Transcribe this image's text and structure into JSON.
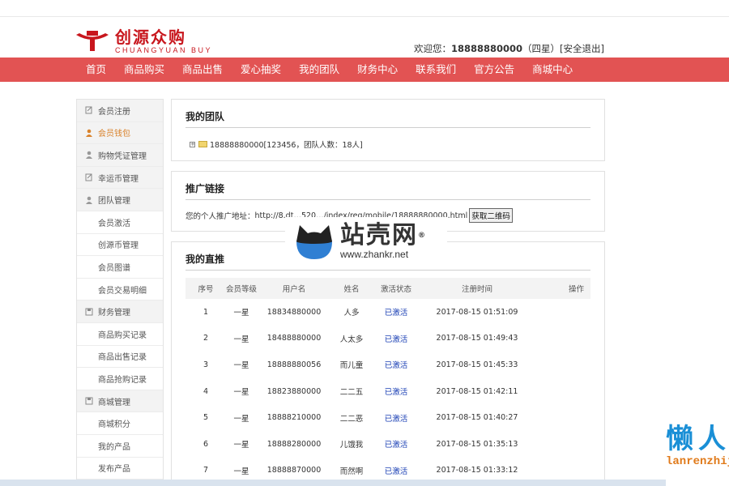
{
  "header": {
    "logo_cn": "创源众购",
    "logo_en": "CHUANGYUAN BUY",
    "welcome_prefix": "欢迎您：",
    "phone": "18888880000",
    "rank": "（四星）",
    "logout": "[安全退出]"
  },
  "nav": [
    "首页",
    "商品购买",
    "商品出售",
    "爱心抽奖",
    "我的团队",
    "财务中心",
    "联系我们",
    "官方公告",
    "商城中心"
  ],
  "sidebar": [
    {
      "label": "会员注册",
      "type": "group",
      "icon": "edit-icon"
    },
    {
      "label": "会员钱包",
      "type": "group",
      "icon": "user-icon",
      "active": true
    },
    {
      "label": "购物凭证管理",
      "type": "group",
      "icon": "user-icon"
    },
    {
      "label": "幸运币管理",
      "type": "group",
      "icon": "edit-icon"
    },
    {
      "label": "团队管理",
      "type": "group",
      "icon": "user-icon"
    },
    {
      "label": "会员激活",
      "type": "child"
    },
    {
      "label": "创源币管理",
      "type": "child"
    },
    {
      "label": "会员图谱",
      "type": "child"
    },
    {
      "label": "会员交易明细",
      "type": "child"
    },
    {
      "label": "财务管理",
      "type": "group",
      "icon": "save-icon"
    },
    {
      "label": "商品购买记录",
      "type": "child"
    },
    {
      "label": "商品出售记录",
      "type": "child"
    },
    {
      "label": "商品抢购记录",
      "type": "child"
    },
    {
      "label": "商城管理",
      "type": "group",
      "icon": "save-icon"
    },
    {
      "label": "商城积分",
      "type": "child"
    },
    {
      "label": "我的产品",
      "type": "child"
    },
    {
      "label": "发布产品",
      "type": "child"
    }
  ],
  "team": {
    "title": "我的团队",
    "node": "18888880000[123456，团队人数：18人]"
  },
  "promo": {
    "title": "推广链接",
    "label": "您的个人推广地址：",
    "url": "http://8.dt…520…/index/reg/mobile/18888880000.html",
    "qr_button": "获取二维码"
  },
  "direct": {
    "title": "我的直推",
    "columns": [
      "序号",
      "会员等级",
      "用户名",
      "姓名",
      "激活状态",
      "注册时间",
      "操作"
    ],
    "rows": [
      [
        "1",
        "一星",
        "18834880000",
        "人多",
        "已激活",
        "2017-08-15 01:51:09",
        ""
      ],
      [
        "2",
        "一星",
        "18488880000",
        "人太多",
        "已激活",
        "2017-08-15 01:49:43",
        ""
      ],
      [
        "3",
        "一星",
        "18888880056",
        "而儿童",
        "已激活",
        "2017-08-15 01:45:33",
        ""
      ],
      [
        "4",
        "一星",
        "18823880000",
        "二二五",
        "已激活",
        "2017-08-15 01:42:11",
        ""
      ],
      [
        "5",
        "一星",
        "18888210000",
        "二二恶",
        "已激活",
        "2017-08-15 01:40:27",
        ""
      ],
      [
        "6",
        "一星",
        "18888280000",
        "儿饿我",
        "已激活",
        "2017-08-15 01:35:13",
        ""
      ],
      [
        "7",
        "一星",
        "18888870000",
        "而然啊",
        "已激活",
        "2017-08-15 01:33:12",
        ""
      ]
    ]
  },
  "watermark": {
    "cn": "站壳网",
    "reg": "®",
    "url": "www.zhankr.net"
  },
  "corner": {
    "cn": "懒人",
    "en": "lanrenzhijia"
  },
  "colors": {
    "nav_bg": "#e25353",
    "brand": "#c8161d",
    "active": "#d9822b",
    "status": "#1a3fb4"
  }
}
